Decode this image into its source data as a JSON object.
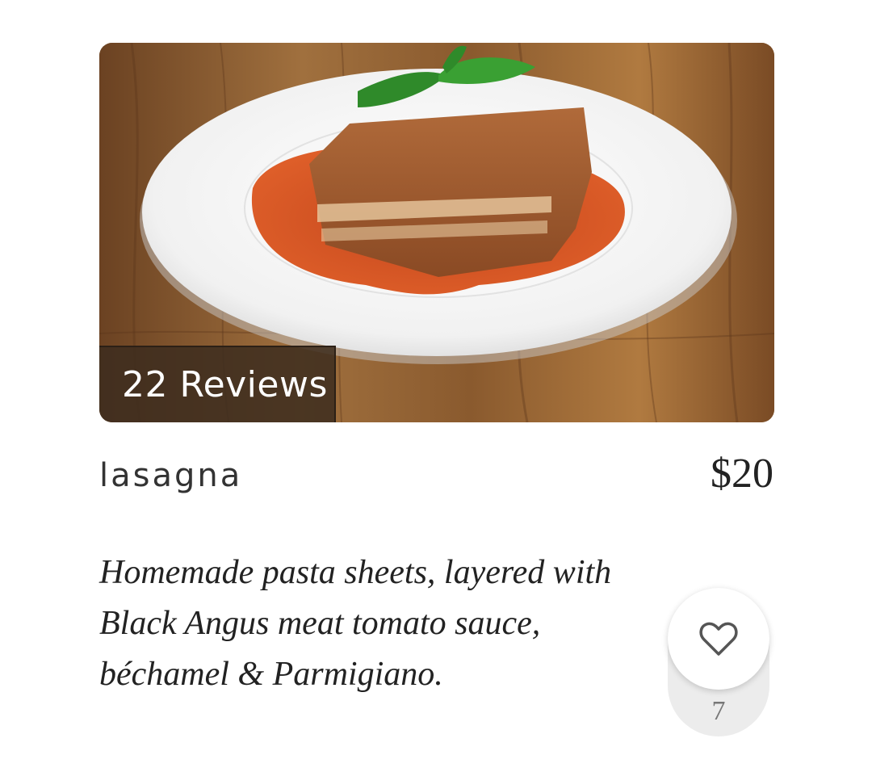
{
  "item": {
    "image_alt": "lasagna on white plate",
    "reviews_label": "22 Reviews",
    "name": "lasagna",
    "price": "$20",
    "description": "Homemade pasta sheets, layered with Black Angus meat tomato sauce, béchamel & Parmigiano.",
    "likes": "7"
  },
  "icons": {
    "like": "heart-outline-icon"
  },
  "colors": {
    "text": "#222222",
    "badge_bg": "#3c2c1e",
    "like_bg": "#ececec"
  }
}
